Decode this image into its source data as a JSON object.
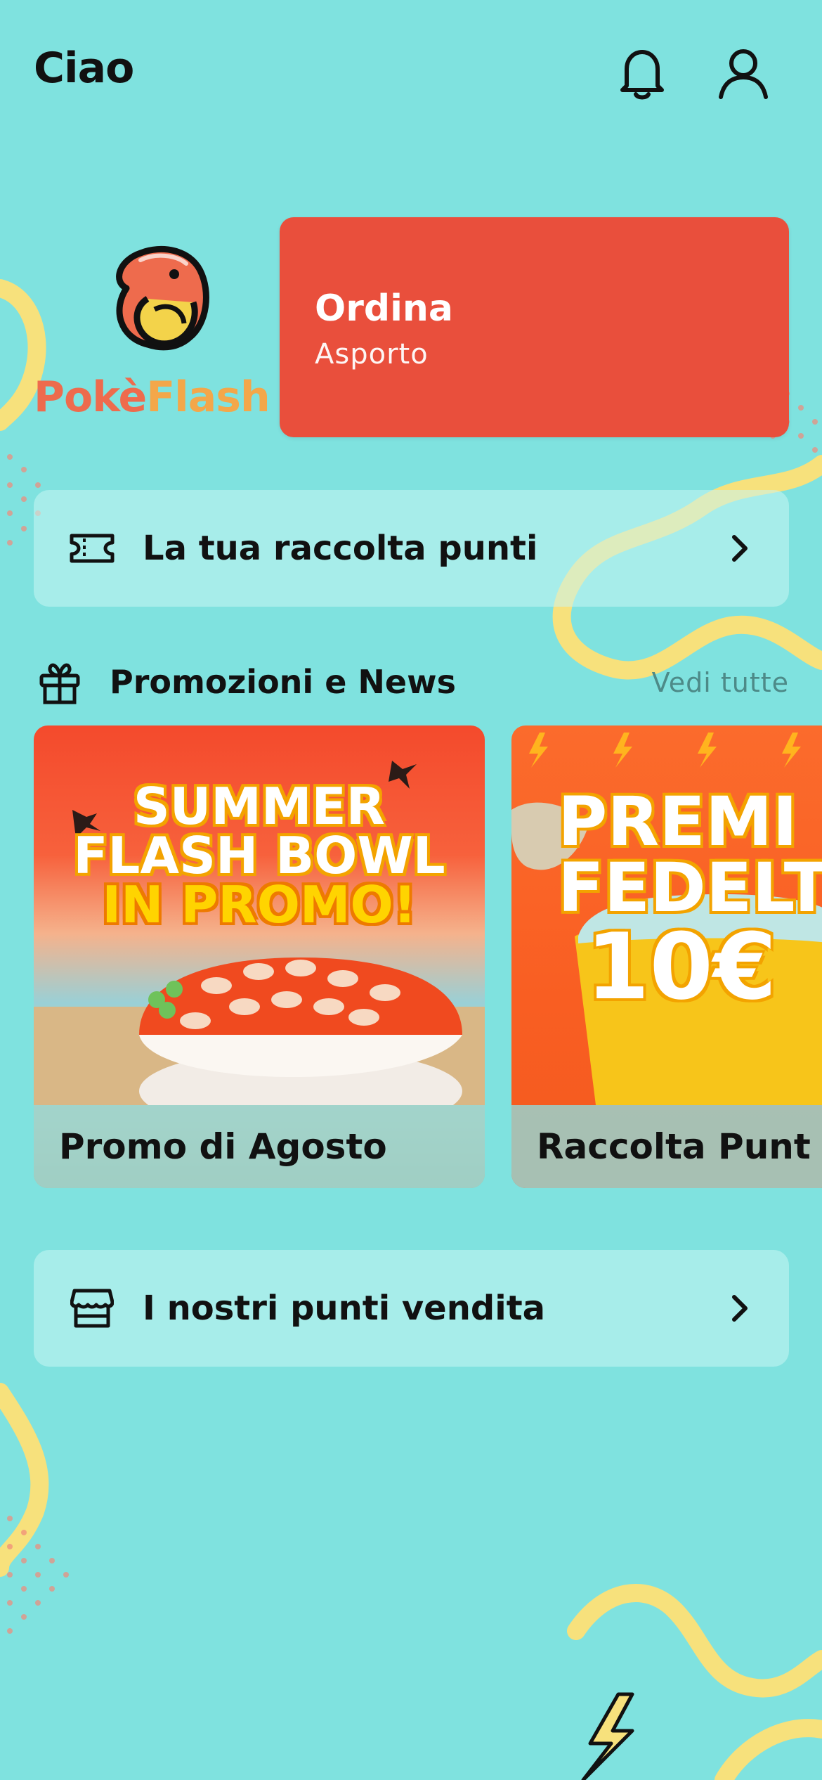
{
  "header": {
    "greeting": "Ciao",
    "icons": [
      "bell-icon",
      "user-icon"
    ]
  },
  "brand": {
    "logo_part1": "Pokè",
    "logo_part2": "Flash",
    "colors": {
      "coral": "#ee6b4d",
      "orange": "#f3a74a"
    }
  },
  "order_card": {
    "title": "Ordina",
    "subtitle": "Asporto",
    "color": "#e94f3c"
  },
  "points_row": {
    "label": "La tua raccolta punti",
    "icon": "ticket-icon"
  },
  "promotions": {
    "icon": "gift-icon",
    "title": "Promozioni e News",
    "see_all": "Vedi tutte",
    "items": [
      {
        "headline_lines": [
          "SUMMER",
          "FLASH BOWL",
          "IN PROMO!"
        ],
        "label": "Promo di Agosto"
      },
      {
        "headline_lines": [
          "PREMI",
          "FEDELT",
          "10€"
        ],
        "label": "Raccolta Punt"
      }
    ]
  },
  "stores_row": {
    "label": "I nostri punti vendita",
    "icon": "store-icon"
  },
  "theme": {
    "background": "#7fe2df",
    "squiggle": "#f7e17c",
    "dots": "#f18a7a"
  }
}
